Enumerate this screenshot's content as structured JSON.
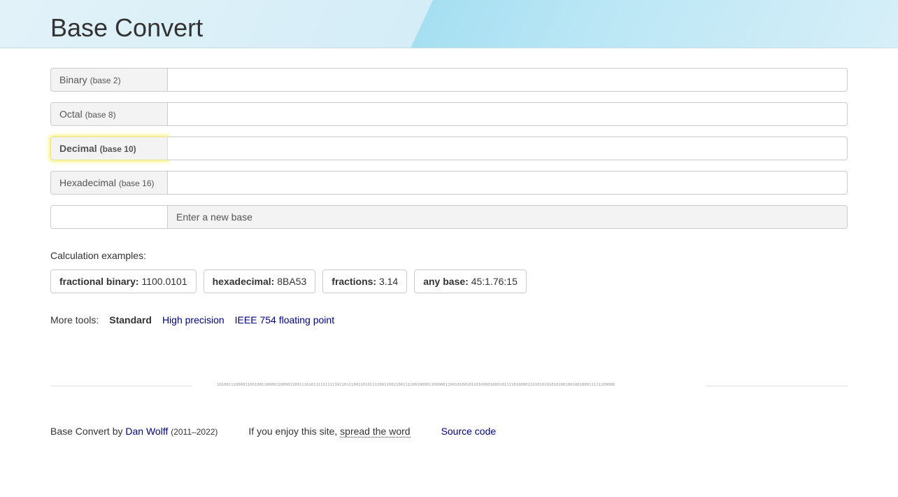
{
  "header": {
    "title": "Base Convert"
  },
  "fields": [
    {
      "name": "Binary",
      "base": "(base 2)",
      "value": ""
    },
    {
      "name": "Octal",
      "base": "(base 8)",
      "value": ""
    },
    {
      "name": "Decimal",
      "base": "(base 10)",
      "value": ""
    },
    {
      "name": "Hexadecimal",
      "base": "(base 16)",
      "value": ""
    }
  ],
  "new_base": {
    "value": "",
    "label": "Enter a new base"
  },
  "examples": {
    "label": "Calculation examples:",
    "items": [
      {
        "type": "fractional binary:",
        "value": "1100.0101"
      },
      {
        "type": "hexadecimal:",
        "value": "8BA53"
      },
      {
        "type": "fractions:",
        "value": "3.14"
      },
      {
        "type": "any base:",
        "value": "45:1.76:15"
      }
    ]
  },
  "tools": {
    "label": "More tools:",
    "current": "Standard",
    "links": [
      "High precision",
      "IEEE 754 floating point"
    ]
  },
  "divider_bits": "1010011100001100100110000110000110011101011111111110110111001101011110011001100111100100001100000110010100101101000010001011110100001101010101010100100100100011111100000",
  "footer": {
    "credit_prefix": "Base Convert by",
    "author": "Dan Wolff",
    "years": "(2011–2022)",
    "enjoy_text": "If you enjoy this site,",
    "spread_link": "spread the word",
    "source_link": "Source code"
  },
  "colors": {
    "link": "#000080",
    "active_glow": "#f7f27a",
    "addon_bg": "#f3f3f3"
  }
}
